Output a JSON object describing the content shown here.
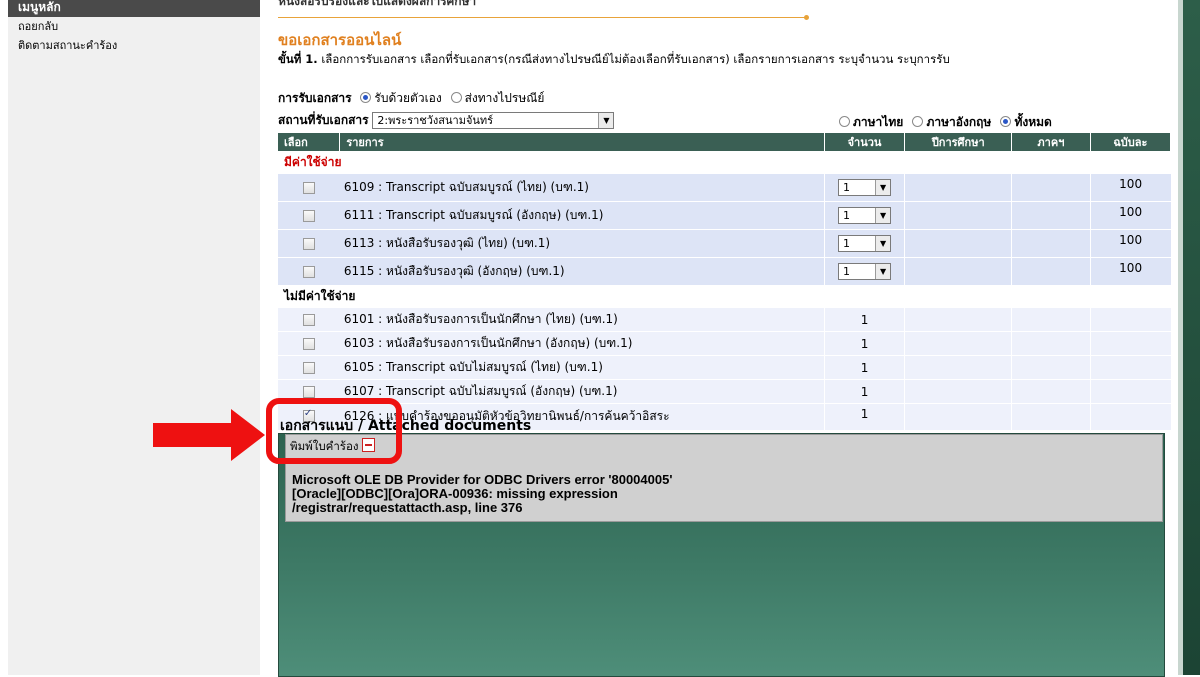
{
  "sidebar": {
    "header": "เมนูหลัก",
    "items": [
      "ถอยกลับ",
      "ติดตามสถานะคำร้อง"
    ]
  },
  "main": {
    "top_cut_text": "หนังสือรับรองและใบแสดงผลการศึกษา",
    "title": "ขอเอกสารออนไลน์",
    "step_label": "ขั้นที่ 1.",
    "step_text": "เลือกการรับเอกสาร เลือกที่รับเอกสาร(กรณีส่งทางไปรษณีย์ไม่ต้องเลือกที่รับเอกสาร) เลือกรายการเอกสาร ระบุจำนวน ระบุการรับ",
    "receive_label": "การรับเอกสาร",
    "receive_self": "รับด้วยตัวเอง",
    "receive_post": "ส่งทางไปรษณีย์",
    "place_label": "สถานที่รับเอกสาร",
    "place_value": "2:พระราชวังสนามจันทร์",
    "lang_thai": "ภาษาไทย",
    "lang_english": "ภาษาอังกฤษ",
    "lang_all": "ทั้งหมด"
  },
  "table": {
    "headers": {
      "select": "เลือก",
      "item": "รายการ",
      "qty": "จำนวน",
      "year": "ปีการศึกษา",
      "term": "ภาคฯ",
      "price": "ฉบับละ"
    },
    "paid_label": "มีค่าใช้จ่าย",
    "free_label": "ไม่มีค่าใช้จ่าย",
    "paid_rows": [
      {
        "item": "6109 : Transcript ฉบับสมบูรณ์ (ไทย) (บฑ.1)",
        "qty": "1",
        "price": "100"
      },
      {
        "item": "6111 : Transcript ฉบับสมบูรณ์ (อังกฤษ) (บฑ.1)",
        "qty": "1",
        "price": "100"
      },
      {
        "item": "6113 : หนังสือรับรองวุฒิ (ไทย) (บฑ.1)",
        "qty": "1",
        "price": "100"
      },
      {
        "item": "6115 : หนังสือรับรองวุฒิ (อังกฤษ) (บฑ.1)",
        "qty": "1",
        "price": "100"
      }
    ],
    "free_rows": [
      {
        "item": "6101 : หนังสือรับรองการเป็นนักศึกษา (ไทย) (บฑ.1)",
        "qty": "1"
      },
      {
        "item": "6103 : หนังสือรับรองการเป็นนักศึกษา (อังกฤษ) (บฑ.1)",
        "qty": "1"
      },
      {
        "item": "6105 : Transcript ฉบับไม่สมบูรณ์ (ไทย) (บฑ.1)",
        "qty": "1"
      },
      {
        "item": "6107 : Transcript ฉบับไม่สมบูรณ์ (อังกฤษ) (บฑ.1)",
        "qty": "1"
      },
      {
        "item": "6126 : แบบคำร้องขออนุมัติหัวข้อวิทยานิพนธ์/การค้นคว้าอิสระ",
        "qty": "1"
      }
    ]
  },
  "attach": {
    "title": "เอกสารแนบ / Attached documents",
    "print_link": "พิมพ์ใบคำร้อง",
    "error_line1": "Microsoft OLE DB Provider for ODBC Drivers  error '80004005'",
    "error_line2": "[Oracle][ODBC][Ora]ORA-00936: missing expression",
    "error_line3": "/registrar/requestattacth.asp, line 376"
  },
  "colors": {
    "accent_orange": "#e0801f",
    "header_green": "#3a5f54",
    "paid_red": "#cc0000",
    "annotation_red": "#ee1111"
  }
}
